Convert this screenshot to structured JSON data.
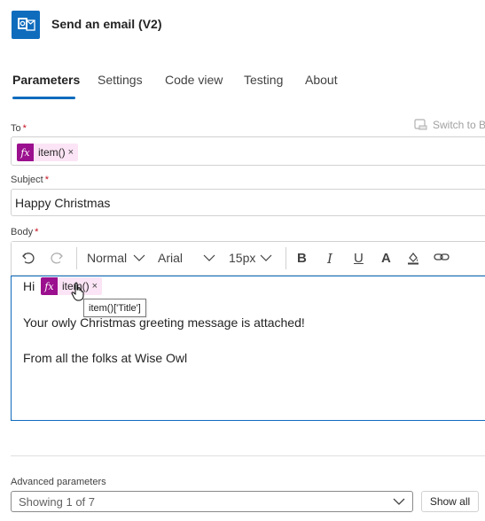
{
  "header": {
    "title": "Send an email (V2)",
    "app_icon": "outlook-icon"
  },
  "tabs": [
    {
      "label": "Parameters",
      "active": true
    },
    {
      "label": "Settings"
    },
    {
      "label": "Code view"
    },
    {
      "label": "Testing"
    },
    {
      "label": "About"
    }
  ],
  "fields": {
    "to": {
      "label": "To",
      "required": "*",
      "token": {
        "icon": "fx",
        "text": "item()",
        "close": "×"
      }
    },
    "switch_label": "Switch to B",
    "subject": {
      "label": "Subject",
      "required": "*",
      "value": "Happy Christmas"
    },
    "body": {
      "label": "Body",
      "required": "*",
      "toolbar": {
        "style": "Normal",
        "font": "Arial",
        "size": "15px"
      },
      "lines": {
        "greeting": "Hi",
        "token": {
          "icon": "fx",
          "text": "item()",
          "close": "×"
        },
        "tooltip": "item()['Title']",
        "line2": "Your owly Christmas greeting message is attached!",
        "line3": "From all the folks at Wise Owl"
      }
    }
  },
  "advanced": {
    "label": "Advanced parameters",
    "select_value": "Showing 1 of 7",
    "show_all": "Show all"
  },
  "colors": {
    "accent": "#0f6cbd",
    "token_bg": "#fbe4f5",
    "token_icon": "#9b108e",
    "required": "#c50f1f"
  }
}
